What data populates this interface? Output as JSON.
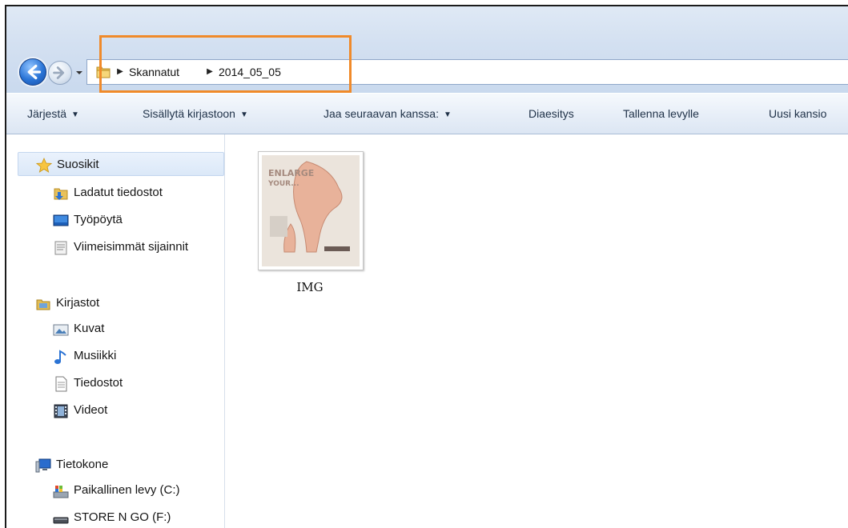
{
  "address_bar": {
    "crumbs": [
      "Skannatut",
      "2014_05_05"
    ]
  },
  "command_bar": {
    "items": [
      {
        "label": "Järjestä",
        "has_dropdown": true
      },
      {
        "label": "Sisällytä kirjastoon",
        "has_dropdown": true
      },
      {
        "label": "Jaa seuraavan kanssa:",
        "has_dropdown": true
      },
      {
        "label": "Diaesitys",
        "has_dropdown": false
      },
      {
        "label": "Tallenna levylle",
        "has_dropdown": false
      },
      {
        "label": "Uusi kansio",
        "has_dropdown": false
      }
    ]
  },
  "sidebar": {
    "favorites": {
      "label": "Suosikit",
      "items": [
        "Ladatut tiedostot",
        "Työpöytä",
        "Viimeisimmät sijainnit"
      ]
    },
    "libraries": {
      "label": "Kirjastot",
      "items": [
        "Kuvat",
        "Musiikki",
        "Tiedostot",
        "Videot"
      ]
    },
    "computer": {
      "label": "Tietokone",
      "items": [
        "Paikallinen levy (C:)",
        "STORE N GO (F:)"
      ]
    }
  },
  "files": [
    {
      "name": "IMG",
      "thumbnail_text": [
        "ENLARGE",
        "YOUR..."
      ]
    }
  ],
  "colors": {
    "highlight": "#f08a2a",
    "nav_background": "#d3e0f1"
  }
}
